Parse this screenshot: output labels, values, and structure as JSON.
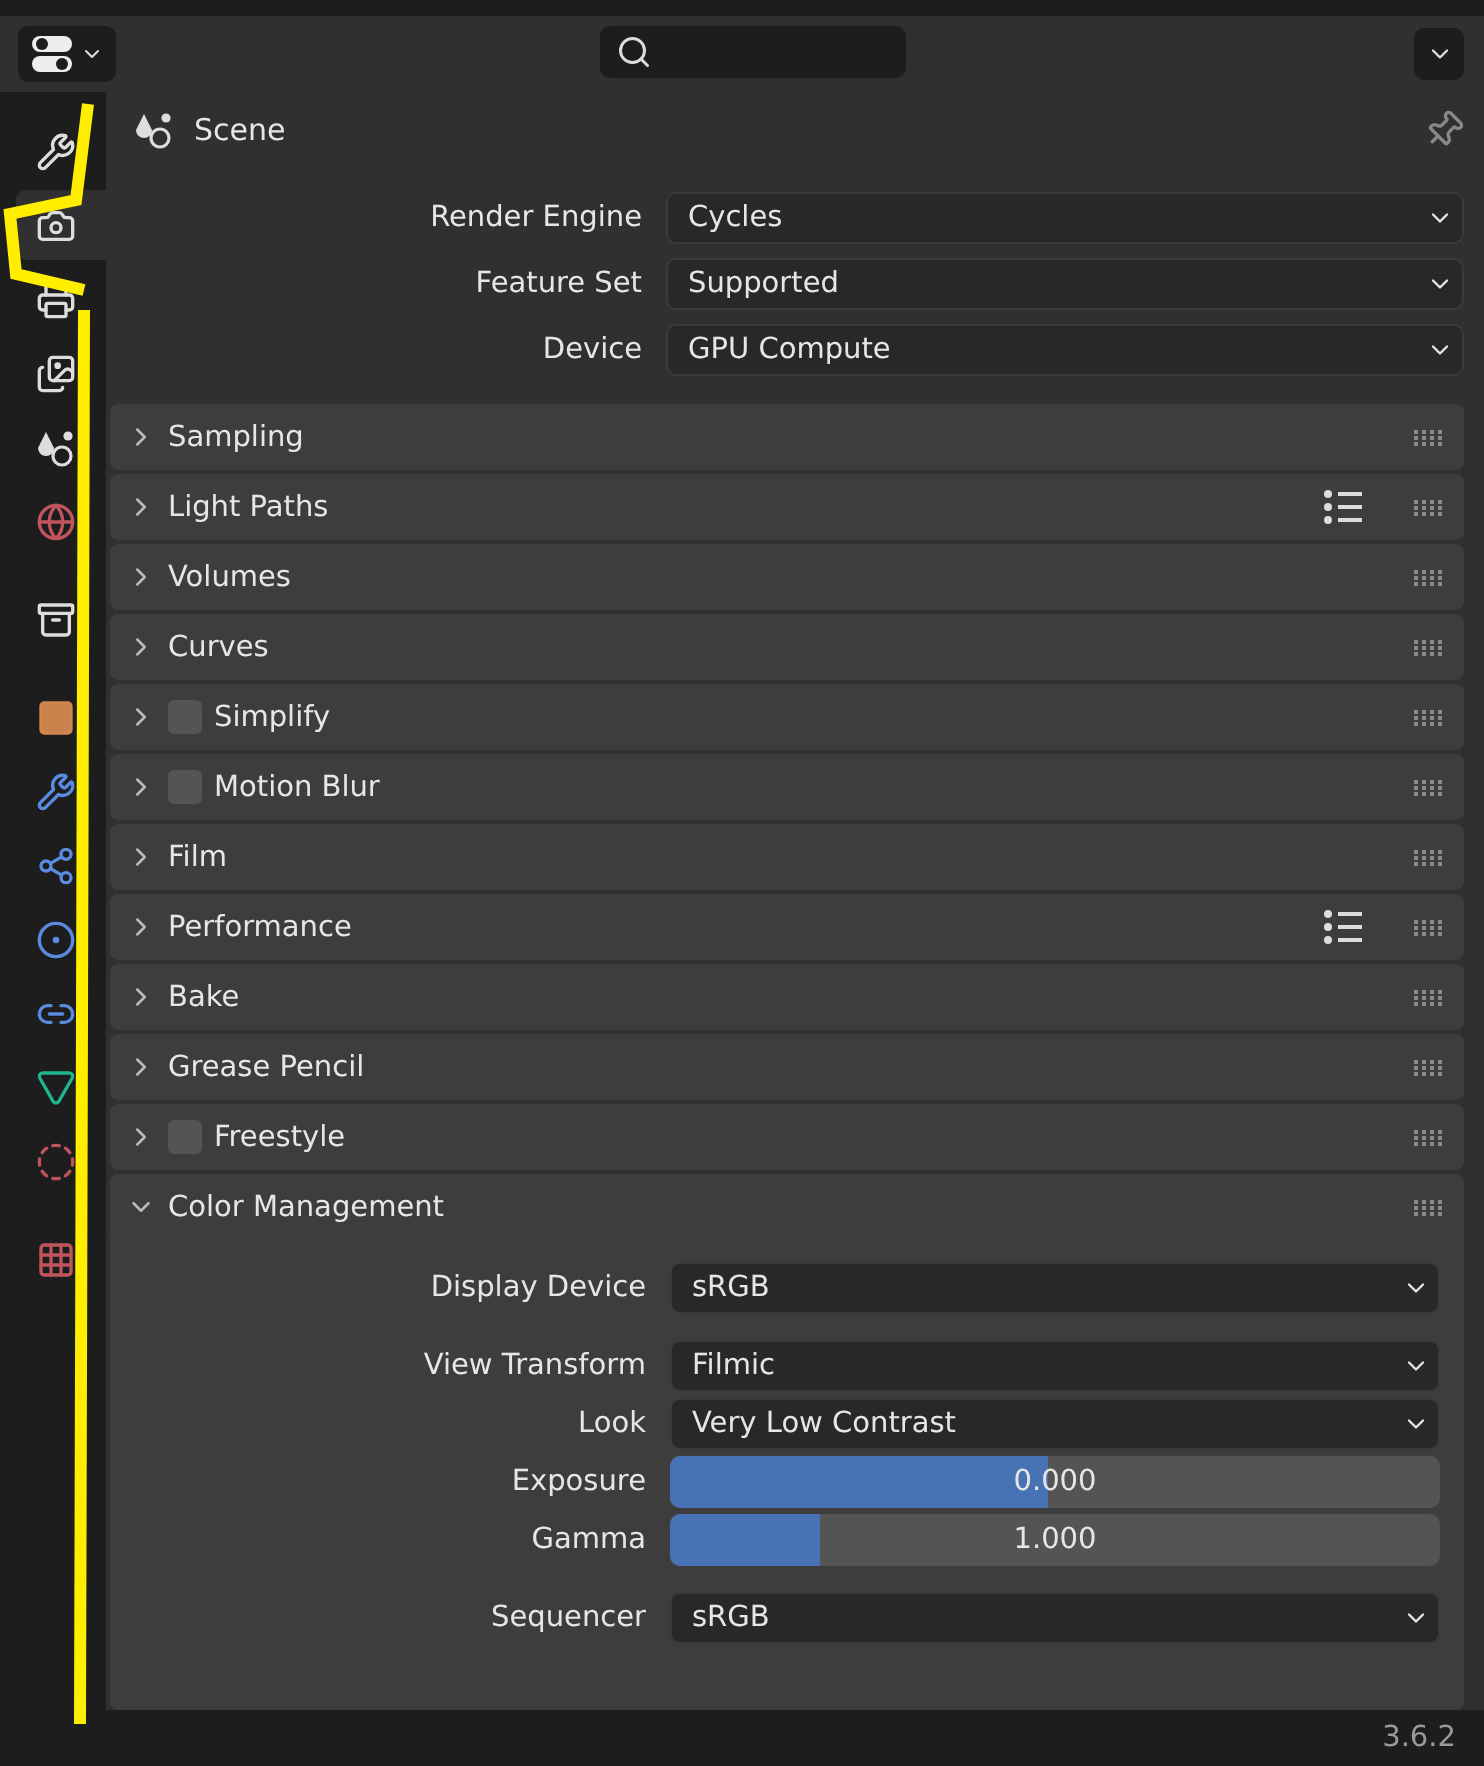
{
  "sidebar": {
    "groups": [
      [
        {
          "kind": "tool",
          "selected": false
        },
        {
          "kind": "render",
          "selected": true
        },
        {
          "kind": "output",
          "selected": false
        },
        {
          "kind": "view_layer",
          "selected": false
        },
        {
          "kind": "scene",
          "selected": false
        },
        {
          "kind": "world",
          "selected": false
        }
      ],
      [
        {
          "kind": "collection",
          "selected": false
        }
      ],
      [
        {
          "kind": "object",
          "selected": false
        },
        {
          "kind": "modifier",
          "selected": false
        },
        {
          "kind": "particles",
          "selected": false
        },
        {
          "kind": "physics",
          "selected": false
        },
        {
          "kind": "constraints",
          "selected": false
        },
        {
          "kind": "data",
          "selected": false
        },
        {
          "kind": "material",
          "selected": false
        }
      ],
      [
        {
          "kind": "texture",
          "selected": false
        }
      ]
    ]
  },
  "context": {
    "title": "Scene"
  },
  "properties": [
    {
      "label": "Render Engine",
      "value": "Cycles"
    },
    {
      "label": "Feature Set",
      "value": "Supported"
    },
    {
      "label": "Device",
      "value": "GPU Compute"
    }
  ],
  "panels": [
    {
      "label": "Sampling",
      "expanded": false,
      "presets": false
    },
    {
      "label": "Light Paths",
      "expanded": false,
      "presets": true
    },
    {
      "label": "Volumes",
      "expanded": false,
      "presets": false
    },
    {
      "label": "Curves",
      "expanded": false,
      "presets": false
    },
    {
      "label": "Simplify",
      "expanded": false,
      "presets": false,
      "checked": false
    },
    {
      "label": "Motion Blur",
      "expanded": false,
      "presets": false,
      "checked": false
    },
    {
      "label": "Film",
      "expanded": false,
      "presets": false
    },
    {
      "label": "Performance",
      "expanded": false,
      "presets": true
    },
    {
      "label": "Bake",
      "expanded": false,
      "presets": false
    },
    {
      "label": "Grease Pencil",
      "expanded": false,
      "presets": false
    },
    {
      "label": "Freestyle",
      "expanded": false,
      "presets": false,
      "checked": false
    },
    {
      "label": "Color Management",
      "expanded": true,
      "presets": false,
      "field_groups": [
        [
          {
            "kind": "dropdown",
            "label": "Display Device",
            "value": "sRGB"
          }
        ],
        [
          {
            "kind": "dropdown",
            "label": "View Transform",
            "value": "Filmic"
          },
          {
            "kind": "dropdown",
            "label": "Look",
            "value": "Very Low Contrast"
          },
          {
            "kind": "slider",
            "label": "Exposure",
            "value": "0.000",
            "level": 0.49
          },
          {
            "kind": "slider",
            "label": "Gamma",
            "value": "1.000",
            "level": 0.195
          }
        ],
        [
          {
            "kind": "dropdown",
            "label": "Sequencer",
            "value": "sRGB"
          }
        ]
      ]
    }
  ],
  "status_bar": {
    "version": "3.6.2"
  }
}
